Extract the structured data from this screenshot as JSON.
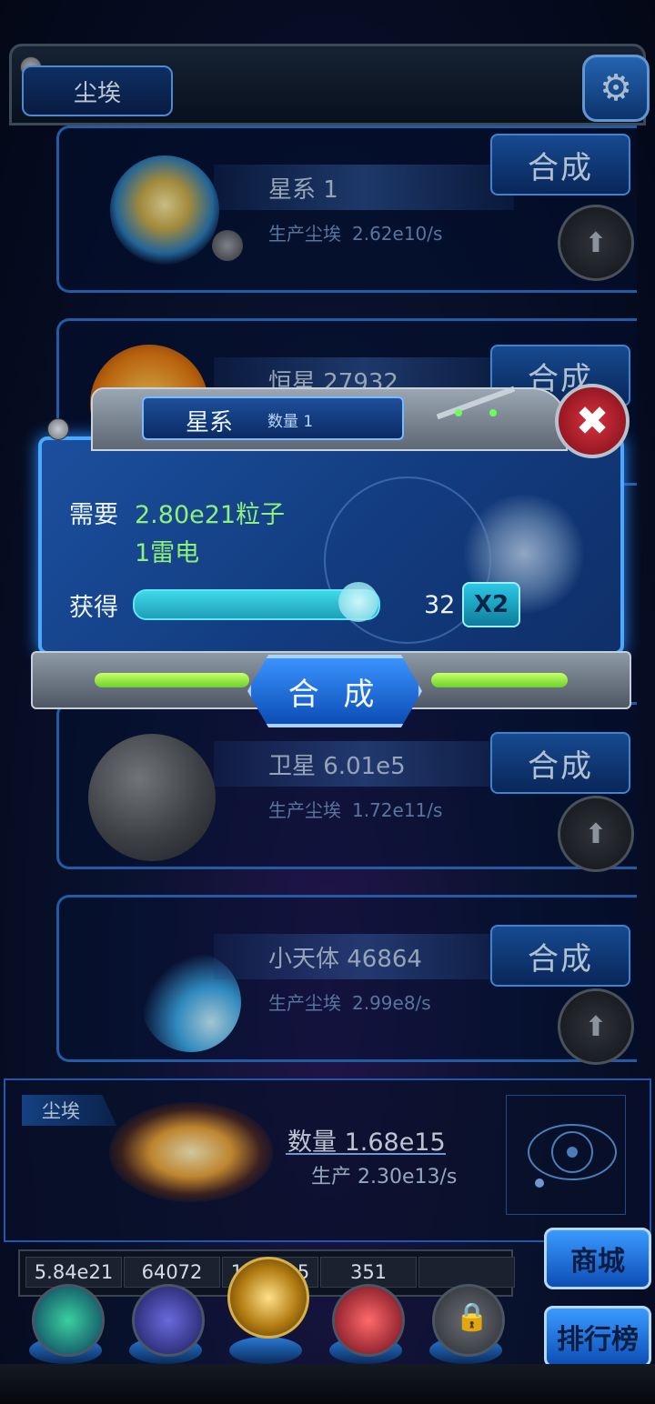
{
  "header": {
    "title": "尘埃"
  },
  "cards": [
    {
      "name": "星系 1",
      "prod_label": "生产尘埃",
      "prod_value": "2.62e10/s",
      "btn": "合成"
    },
    {
      "name": "恒星 27932",
      "prod_label": "",
      "prod_value": "",
      "btn": "合成"
    },
    {
      "name": "卫星 6.01e5",
      "prod_label": "生产尘埃",
      "prod_value": "1.72e11/s",
      "btn": "合成"
    },
    {
      "name": "小天体 46864",
      "prod_label": "生产尘埃",
      "prod_value": "2.99e8/s",
      "btn": "合成"
    }
  ],
  "dialog": {
    "tab_title": "星系",
    "tab_count": "数量 1",
    "need_label": "需要",
    "need_1": "2.80e21粒子",
    "need_2": "1雷电",
    "get_label": "获得",
    "get_value": "32",
    "multiplier": "X2",
    "slider_level": 0.85,
    "confirm": "合 成",
    "close_symbol": "✖"
  },
  "dust": {
    "tag": "尘埃",
    "amount": "数量 1.68e15",
    "production": "生产 2.30e13/s"
  },
  "resources": [
    "5.84e21",
    "64072",
    "1.68e15",
    "351",
    ""
  ],
  "side_buttons": {
    "shop": "商城",
    "rank": "排行榜"
  },
  "colors": {
    "accent": "#2b6fc9",
    "highlight_green": "#8ff07a",
    "cyan": "#3fd8e8",
    "danger": "#d8313e"
  }
}
